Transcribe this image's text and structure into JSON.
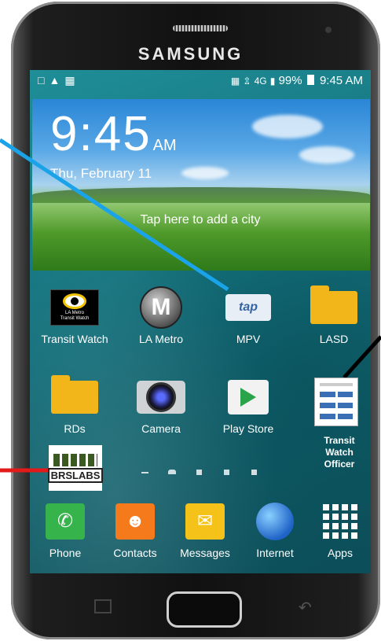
{
  "device": {
    "brand": "SAMSUNG"
  },
  "status_bar": {
    "left_icons": [
      "notification-icon",
      "warning-icon",
      "sim-icon"
    ],
    "battery": "99%",
    "time": "9:45 AM",
    "network": "4G"
  },
  "widget": {
    "time": "9:45",
    "ampm": "AM",
    "date": "Thu, February 11",
    "prompt": "Tap here to add a city"
  },
  "apps_row1": [
    {
      "label": "Transit Watch"
    },
    {
      "label": "LA Metro"
    },
    {
      "label": "MPV"
    },
    {
      "label": "LASD"
    }
  ],
  "apps_row2": [
    {
      "label": "RDs"
    },
    {
      "label": "Camera"
    },
    {
      "label": "Play Store"
    }
  ],
  "overlay_officer": {
    "label": "Transit Watch Officer"
  },
  "overlay_brs": {
    "text": "BRSLABS"
  },
  "tap_text": "tap",
  "metro_letter": "M",
  "dock": [
    {
      "label": "Phone"
    },
    {
      "label": "Contacts"
    },
    {
      "label": "Messages"
    },
    {
      "label": "Internet"
    },
    {
      "label": "Apps"
    }
  ],
  "colors": {
    "blue_line": "#1aa3e8",
    "black_line": "#000000",
    "red_line": "#e21a1a",
    "folder": "#f2b51a"
  }
}
